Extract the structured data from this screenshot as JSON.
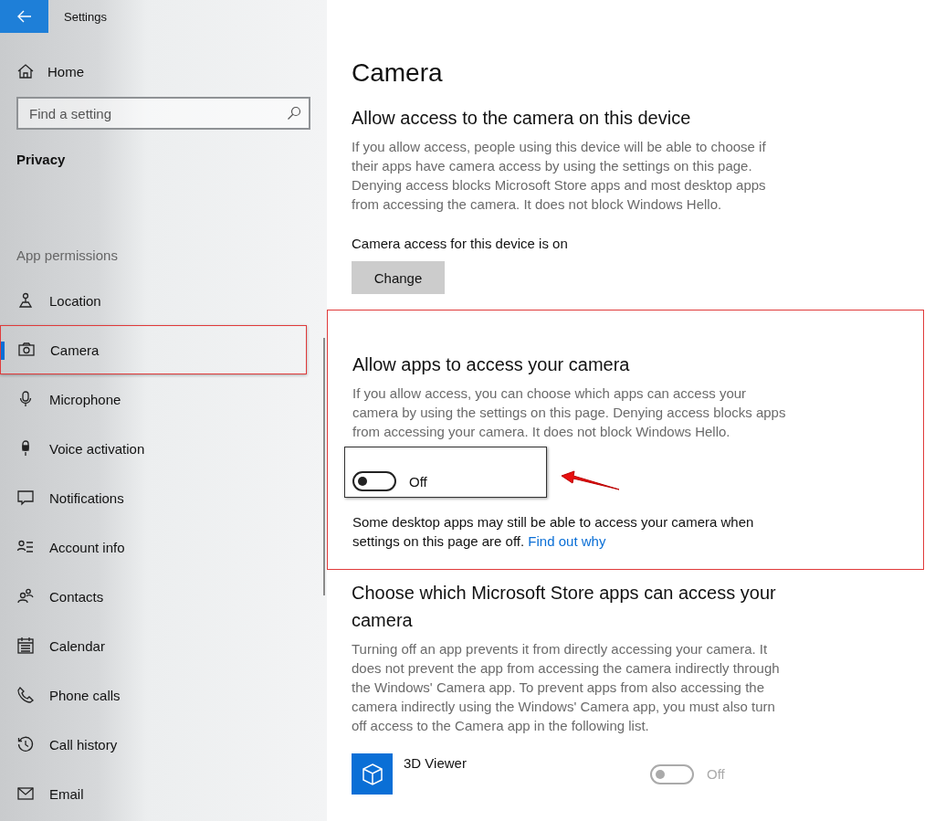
{
  "window": {
    "title": "Settings"
  },
  "sidebar": {
    "home": "Home",
    "search": {
      "placeholder": "Find a setting"
    },
    "section": "Privacy",
    "group": "App permissions",
    "items": [
      {
        "label": "Location",
        "selected": false,
        "highlighted": false
      },
      {
        "label": "Camera",
        "selected": true,
        "highlighted": true
      },
      {
        "label": "Microphone",
        "selected": false,
        "highlighted": false
      },
      {
        "label": "Voice activation",
        "selected": false,
        "highlighted": false
      },
      {
        "label": "Notifications",
        "selected": false,
        "highlighted": false
      },
      {
        "label": "Account info",
        "selected": false,
        "highlighted": false
      },
      {
        "label": "Contacts",
        "selected": false,
        "highlighted": false
      },
      {
        "label": "Calendar",
        "selected": false,
        "highlighted": false
      },
      {
        "label": "Phone calls",
        "selected": false,
        "highlighted": false
      },
      {
        "label": "Call history",
        "selected": false,
        "highlighted": false
      },
      {
        "label": "Email",
        "selected": false,
        "highlighted": false
      }
    ]
  },
  "page": {
    "title": "Camera",
    "device_access": {
      "heading": "Allow access to the camera on this device",
      "description": "If you allow access, people using this device will be able to choose if their apps have camera access by using the settings on this page. Denying access blocks Microsoft Store apps and most desktop apps from accessing the camera. It does not block Windows Hello.",
      "status": "Camera access for this device is on",
      "button": "Change"
    },
    "app_access": {
      "highlighted": true,
      "heading": "Allow apps to access your camera",
      "description": "If you allow access, you can choose which apps can access your camera by using the settings on this page. Denying access blocks apps from accessing your camera. It does not block Windows Hello.",
      "toggle": {
        "on": false,
        "label": "Off",
        "highlighted": true
      },
      "note": "Some desktop apps may still be able to access your camera when settings on this page are off.",
      "link": "Find out why"
    },
    "store_apps": {
      "heading": "Choose which Microsoft Store apps can access your camera",
      "description": "Turning off an app prevents it from directly accessing your camera. It does not prevent the app from accessing the camera indirectly through the Windows' Camera app. To prevent apps from also accessing the camera indirectly using the Windows' Camera app, you must also turn off access to the Camera app in the following list.",
      "apps": [
        {
          "name": "3D Viewer",
          "on": false,
          "disabled": true,
          "label": "Off"
        }
      ]
    }
  }
}
